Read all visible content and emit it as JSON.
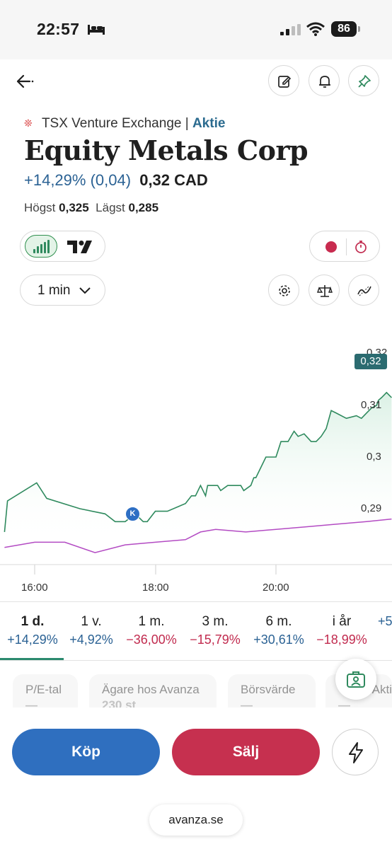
{
  "status_bar": {
    "time": "22:57",
    "battery": "86"
  },
  "header": {
    "back_icon": "arrow-left-icon",
    "actions": [
      "edit-note-icon",
      "bell-icon",
      "pin-icon"
    ]
  },
  "instrument": {
    "country_flag": "canada-flag",
    "exchange": "TSX Venture Exchange",
    "separator": "|",
    "type": "Aktie",
    "name": "Equity Metals Corp",
    "change_pct": "+14,29%",
    "change_abs": "(0,04)",
    "last_price": "0,32 CAD",
    "high_label": "Högst",
    "high_value": "0,325",
    "low_label": "Lägst",
    "low_value": "0,285"
  },
  "controls": {
    "chart_mode_active": "bar-chart-icon",
    "chart_mode_other": "tradingview-icon",
    "record_icon": "record-dot-icon",
    "timer_icon": "stopwatch-icon",
    "interval": "1 min",
    "tools": [
      "gear-icon",
      "scale-icon",
      "indicator-icon"
    ]
  },
  "chart_data": {
    "type": "line",
    "title": "",
    "xlabel": "",
    "ylabel": "",
    "x_ticks": [
      "16:00",
      "18:00",
      "20:00"
    ],
    "y_ticks": [
      "0,29",
      "0,3",
      "0,31",
      "0,32"
    ],
    "ylim": [
      0.2785,
      0.3265
    ],
    "grid": false,
    "current_price_tag": "0,32",
    "marker_label": "K",
    "series": [
      {
        "color": "#2f8a5e",
        "times": [
          "15:30",
          "15:33",
          "16:02",
          "16:12",
          "16:45",
          "17:10",
          "17:20",
          "17:30",
          "17:40",
          "17:48",
          "17:52",
          "18:00",
          "18:12",
          "18:30",
          "18:36",
          "18:40",
          "18:45",
          "18:50",
          "18:52",
          "18:55",
          "19:02",
          "19:05",
          "19:12",
          "19:18",
          "19:25",
          "19:28",
          "19:35",
          "19:38",
          "19:40",
          "19:45",
          "19:50",
          "19:55",
          "19:58",
          "20:00",
          "20:05",
          "20:12",
          "20:15",
          "20:18",
          "20:22",
          "20:28",
          "20:35",
          "20:40",
          "20:45",
          "20:50",
          "20:55",
          "21:00",
          "21:10",
          "21:20",
          "21:25",
          "21:30",
          "21:35",
          "21:40",
          "21:42",
          "21:45",
          "21:50",
          "21:55"
        ],
        "values": [
          0.2855,
          0.2915,
          0.295,
          0.292,
          0.29,
          0.289,
          0.2875,
          0.2875,
          0.289,
          0.2875,
          0.2875,
          0.2895,
          0.2895,
          0.291,
          0.2925,
          0.2925,
          0.2945,
          0.2925,
          0.2945,
          0.2945,
          0.2945,
          0.2935,
          0.2945,
          0.2945,
          0.2945,
          0.2935,
          0.2945,
          0.296,
          0.296,
          0.298,
          0.3,
          0.3,
          0.3,
          0.3,
          0.303,
          0.303,
          0.304,
          0.305,
          0.304,
          0.3045,
          0.303,
          0.303,
          0.304,
          0.3055,
          0.309,
          0.3085,
          0.3075,
          0.308,
          0.3075,
          0.3085,
          0.3095,
          0.31,
          0.311,
          0.3115,
          0.3125,
          0.3115
        ]
      },
      {
        "color": "#b34bc3",
        "times": [
          "15:30",
          "16:00",
          "16:30",
          "17:00",
          "17:30",
          "18:00",
          "18:30",
          "18:45",
          "19:00",
          "19:30",
          "20:00",
          "20:30",
          "21:00",
          "21:30",
          "21:55"
        ],
        "values": [
          0.2825,
          0.2835,
          0.2835,
          0.2815,
          0.283,
          0.2835,
          0.284,
          0.2855,
          0.286,
          0.2855,
          0.286,
          0.2865,
          0.287,
          0.2875,
          0.288
        ]
      }
    ]
  },
  "periods": [
    {
      "label": "1 d.",
      "value": "+14,29%",
      "sign": "pos",
      "active": true
    },
    {
      "label": "1 v.",
      "value": "+4,92%",
      "sign": "pos"
    },
    {
      "label": "1 m.",
      "value": "−36,00%",
      "sign": "neg"
    },
    {
      "label": "3 m.",
      "value": "−15,79%",
      "sign": "neg"
    },
    {
      "label": "6 m.",
      "value": "+30,61%",
      "sign": "pos"
    },
    {
      "label": "i år",
      "value": "−18,99%",
      "sign": "neg"
    },
    {
      "label": "",
      "value": "+5",
      "sign": "pos"
    }
  ],
  "key_figures": [
    {
      "label": "P/E-tal",
      "value": "—"
    },
    {
      "label": "Ägare hos Avanza",
      "value": "230 st"
    },
    {
      "label": "Börsvärde",
      "value": "—"
    },
    {
      "label": "Akti",
      "value": "—"
    }
  ],
  "fab_icon": "portfolio-icon",
  "actions": {
    "buy": "Köp",
    "sell": "Sälj",
    "quick_icon": "lightning-icon"
  },
  "footer_url": "avanza.se"
}
